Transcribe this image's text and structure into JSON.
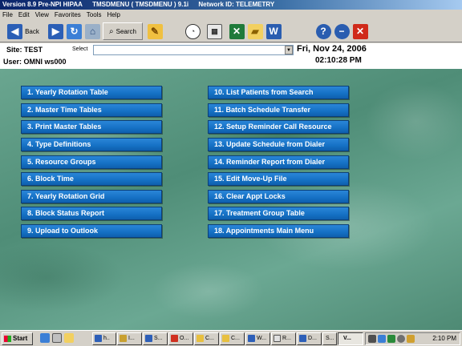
{
  "titlebar": {
    "version": "Version 8.9 Pre-NPI HIPAA",
    "module": "TMSDMENU ( TMSDMENU ) 9.1i",
    "network": "Network ID: TELEMETRY"
  },
  "menubar": [
    "File",
    "Edit",
    "View",
    "Favorites",
    "Tools",
    "Help"
  ],
  "toolbar": {
    "back_label": "Back",
    "search_label": "Search"
  },
  "info": {
    "site": "Site: TEST",
    "select_label": "Select",
    "select_value": "",
    "date": "Fri, Nov 24, 2006",
    "user": "User: OMNI ws000",
    "time": "02:10:28 PM"
  },
  "menu": {
    "left": [
      "1.  Yearly Rotation Table",
      "2.  Master Time Tables",
      "3.  Print Master Tables",
      "4.  Type Definitions",
      "5.  Resource Groups",
      "6.  Block Time",
      "7.  Yearly Rotation Grid",
      "8.  Block Status Report",
      "9.  Upload to Outlook"
    ],
    "right": [
      "10.  List Patients from Search",
      "11.  Batch Schedule Transfer",
      "12.  Setup Reminder Call Resource",
      "13.  Update Schedule from Dialer",
      "14.  Reminder Report from Dialer",
      "15.  Edit Move-Up File",
      "16.  Clear Appt Locks",
      "17.  Treatment Group Table",
      "18.  Appointments Main Menu"
    ]
  },
  "taskbar": {
    "start_label": "Start",
    "tasks": [
      "h..",
      "I...",
      "S...",
      "O...",
      "C...",
      "C...",
      "W...",
      "R...",
      "D...",
      "S...",
      "V..."
    ],
    "clock": "2:10 PM"
  },
  "colors": {
    "button_blue": "#1570c4",
    "background_green": "#5c9a83",
    "title_blue": "#0a246a"
  }
}
